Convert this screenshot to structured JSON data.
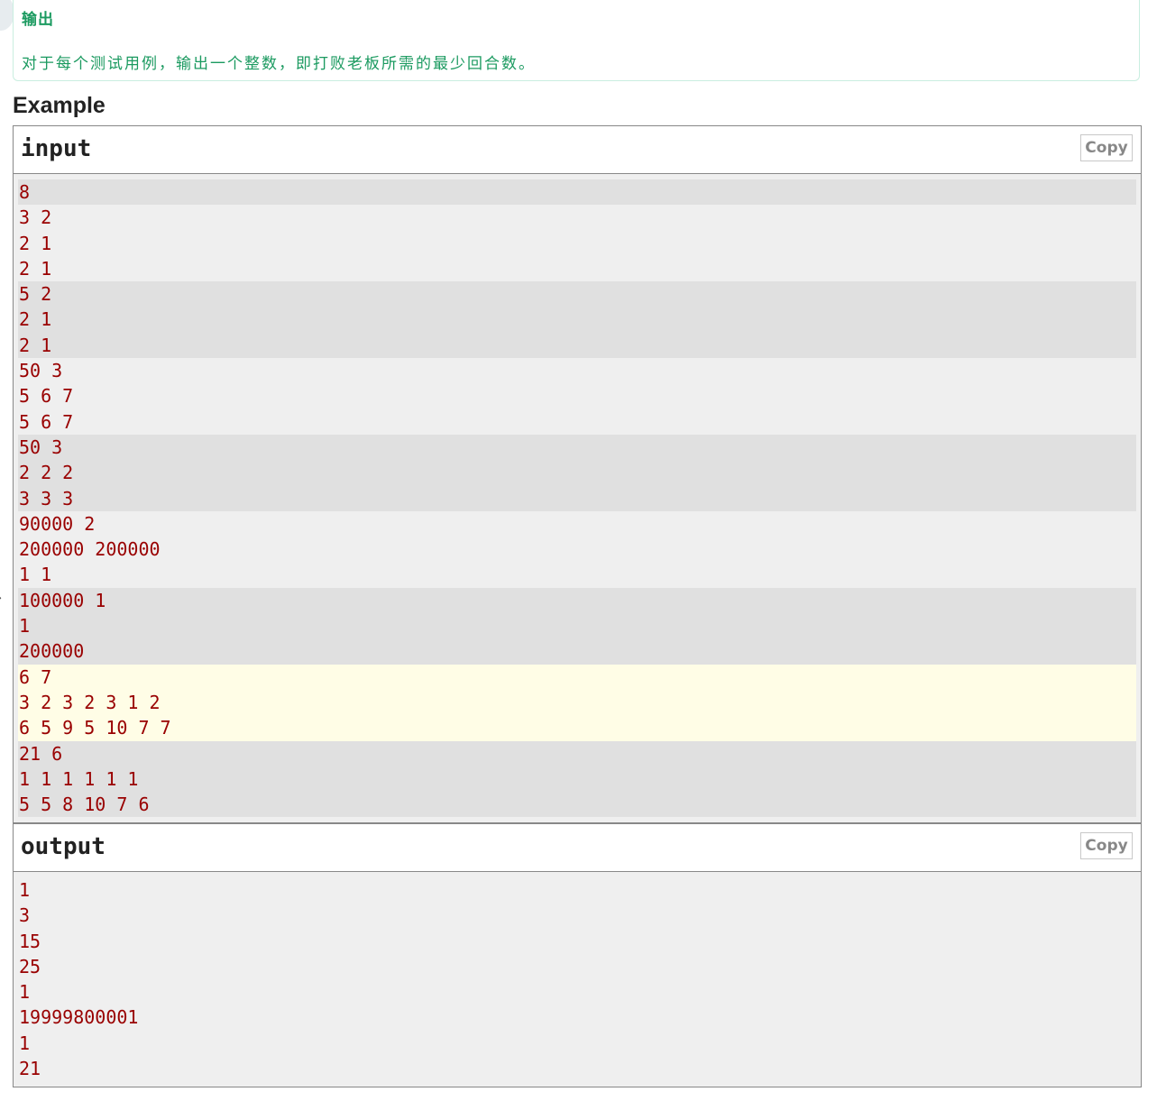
{
  "output_spec": {
    "title": "输出",
    "text": "对于每个测试用例，输出一个整数，即打败老板所需的最少回合数。"
  },
  "example": {
    "heading": "Example",
    "input": {
      "title": "input",
      "copy_label": "Copy",
      "lines": [
        "8",
        "3 2",
        "2 1",
        "2 1",
        "5 2",
        "2 1",
        "2 1",
        "50 3",
        "5 6 7",
        "5 6 7",
        "50 3",
        "2 2 2",
        "3 3 3",
        "90000 2",
        "200000 200000",
        "1 1",
        "100000 1",
        "1",
        "200000",
        "6 7",
        "3 2 3 2 3 1 2",
        "6 5 9 5 10 7 7",
        "21 6",
        "1 1 1 1 1 1",
        "5 5 8 10 7 6"
      ],
      "groups": [
        1,
        3,
        3,
        3,
        3,
        3,
        3,
        3,
        3
      ],
      "highlighted_group": 7
    },
    "output": {
      "title": "output",
      "copy_label": "Copy",
      "lines": [
        "1",
        "3",
        "15",
        "25",
        "1",
        "19999800001",
        "1",
        "21"
      ]
    }
  },
  "colors": {
    "accent_green": "#1b9a60",
    "sample_text": "#990000",
    "odd_group_bg": "#e0e0e0",
    "highlight_bg": "#fffde6"
  }
}
